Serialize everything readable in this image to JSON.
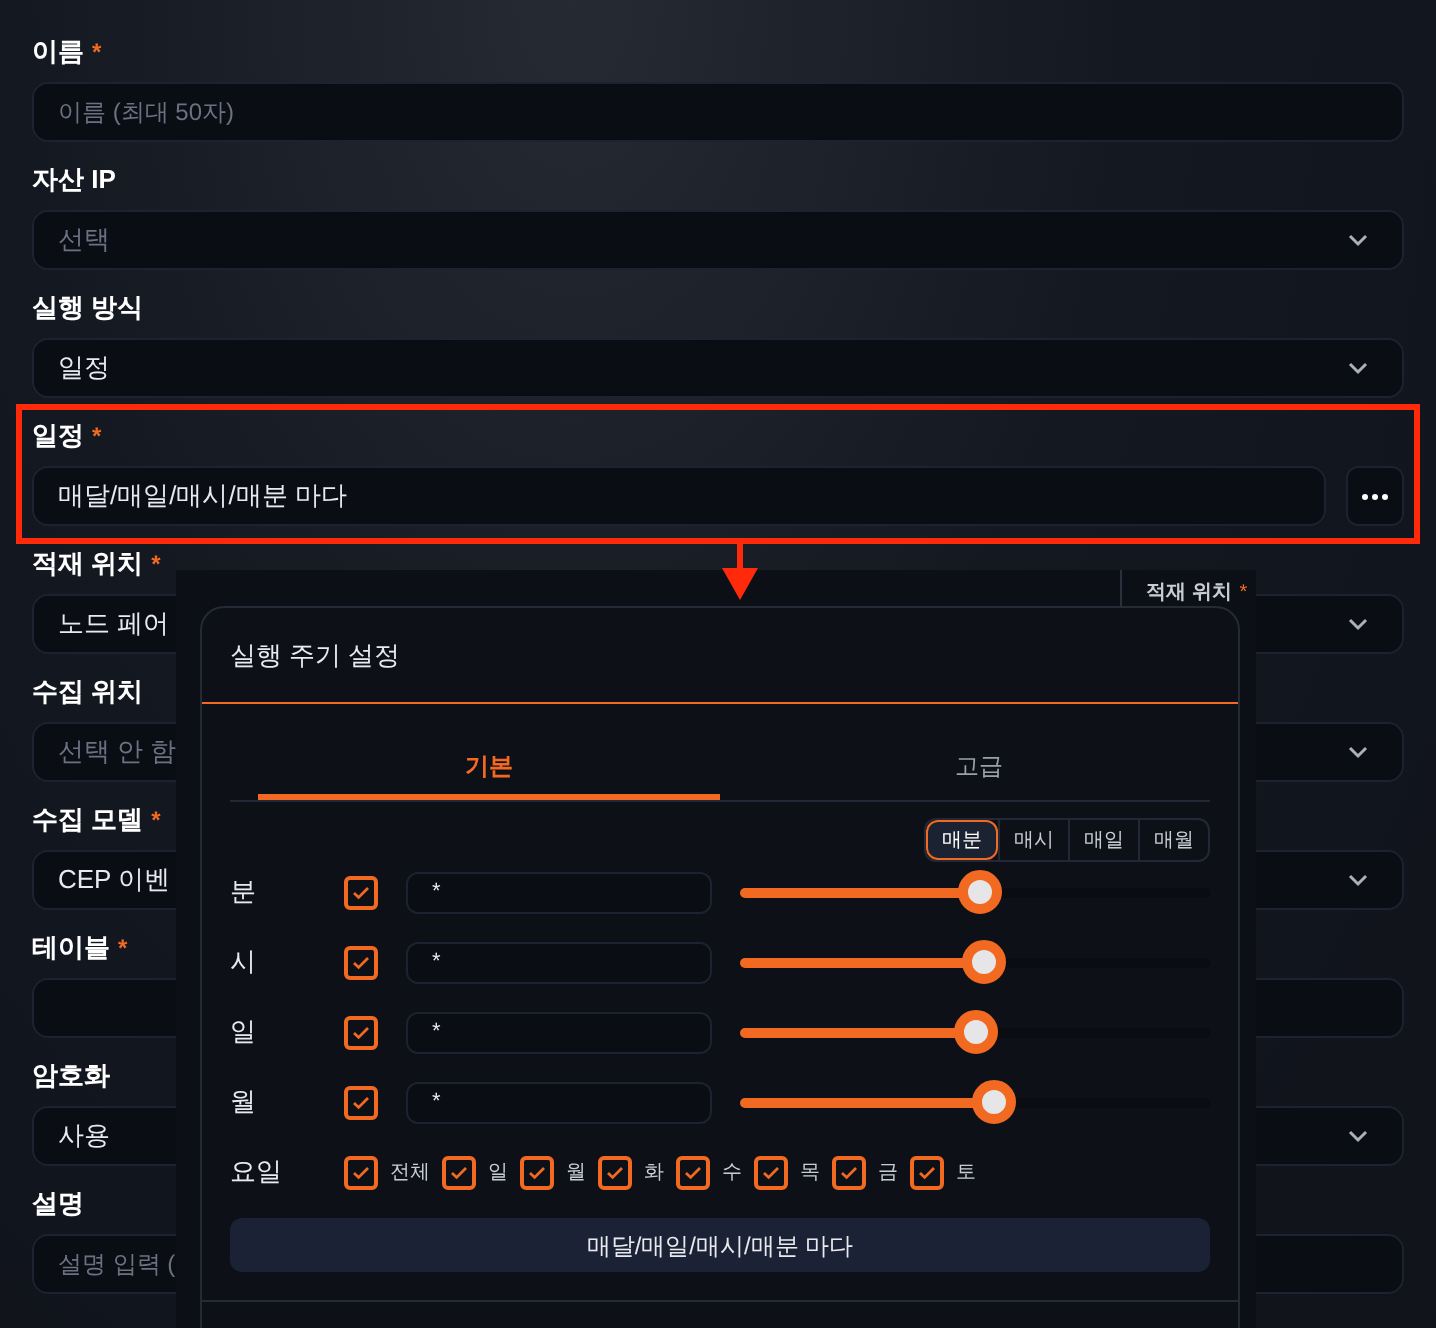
{
  "form": {
    "fields": [
      {
        "label": "이름",
        "required_mark": "*",
        "kind": "input",
        "placeholder": "이름 (최대 50자)"
      },
      {
        "label": "자산 IP",
        "kind": "select",
        "placeholder": "선택"
      },
      {
        "label": "실행 방식",
        "kind": "select",
        "value": "일정"
      },
      {
        "label": "일정",
        "required_mark": "*",
        "kind": "schedule",
        "value": "매달/매일/매시/매분 마다",
        "highlighted": true
      },
      {
        "label": "적재 위치",
        "required_mark": "*",
        "kind": "select",
        "value": "노드 페어"
      },
      {
        "label": "수집 위치",
        "kind": "select",
        "placeholder": "선택 안 함"
      },
      {
        "label": "수집 모델",
        "required_mark": "*",
        "kind": "select",
        "value": "CEP 이벤"
      },
      {
        "label": "테이블",
        "required_mark": "*",
        "kind": "input"
      },
      {
        "label": "암호화",
        "kind": "select",
        "value": "사용"
      },
      {
        "label": "설명",
        "kind": "input",
        "placeholder": "설명 입력 ("
      }
    ]
  },
  "side_panel": {
    "label": "적재 위치",
    "required_mark": "*"
  },
  "dialog": {
    "title": "실행 주기 설정",
    "tabs": [
      {
        "label": "기본",
        "selected": true
      },
      {
        "label": "고급",
        "selected": false
      }
    ],
    "presets": [
      {
        "label": "매분",
        "selected": true
      },
      {
        "label": "매시",
        "selected": false
      },
      {
        "label": "매일",
        "selected": false
      },
      {
        "label": "매월",
        "selected": false
      }
    ],
    "rows": [
      {
        "label": "분",
        "checked": true,
        "value": "*",
        "level": 0.51
      },
      {
        "label": "시",
        "checked": true,
        "value": "*",
        "level": 0.52
      },
      {
        "label": "일",
        "checked": true,
        "value": "*",
        "level": 0.5
      },
      {
        "label": "월",
        "checked": true,
        "value": "*",
        "level": 0.54
      }
    ],
    "weekdays": {
      "label": "요일",
      "items": [
        {
          "label": "전체",
          "checked": true
        },
        {
          "label": "일",
          "checked": true
        },
        {
          "label": "월",
          "checked": true
        },
        {
          "label": "화",
          "checked": true
        },
        {
          "label": "수",
          "checked": true
        },
        {
          "label": "목",
          "checked": true
        },
        {
          "label": "금",
          "checked": true
        },
        {
          "label": "토",
          "checked": true
        }
      ]
    },
    "summary_button": "매달/매일/매시/매분 마다"
  }
}
